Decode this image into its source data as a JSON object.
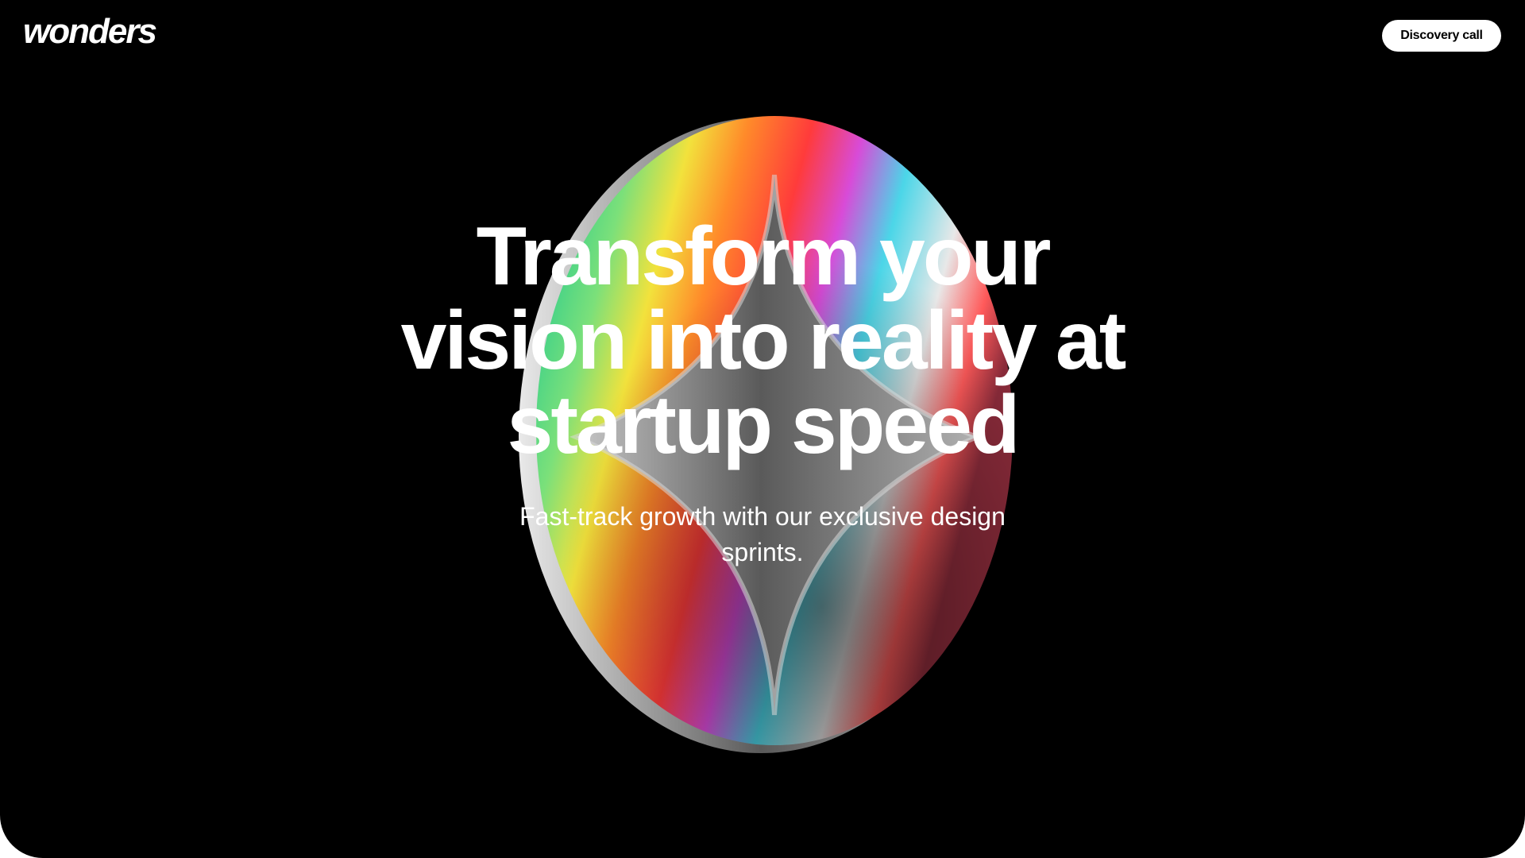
{
  "brand": {
    "logo_text": "wonders"
  },
  "header": {
    "cta_label": "Discovery call"
  },
  "hero": {
    "headline_lines": [
      "Transform your",
      "vision into reality at",
      "startup speed"
    ],
    "subtitle": "Fast-track growth with our exclusive design sprints."
  },
  "artwork": {
    "icon": "holographic-star-coin"
  },
  "colors": {
    "background": "#000000",
    "text": "#ffffff",
    "button_bg": "#ffffff",
    "button_text": "#000000"
  }
}
